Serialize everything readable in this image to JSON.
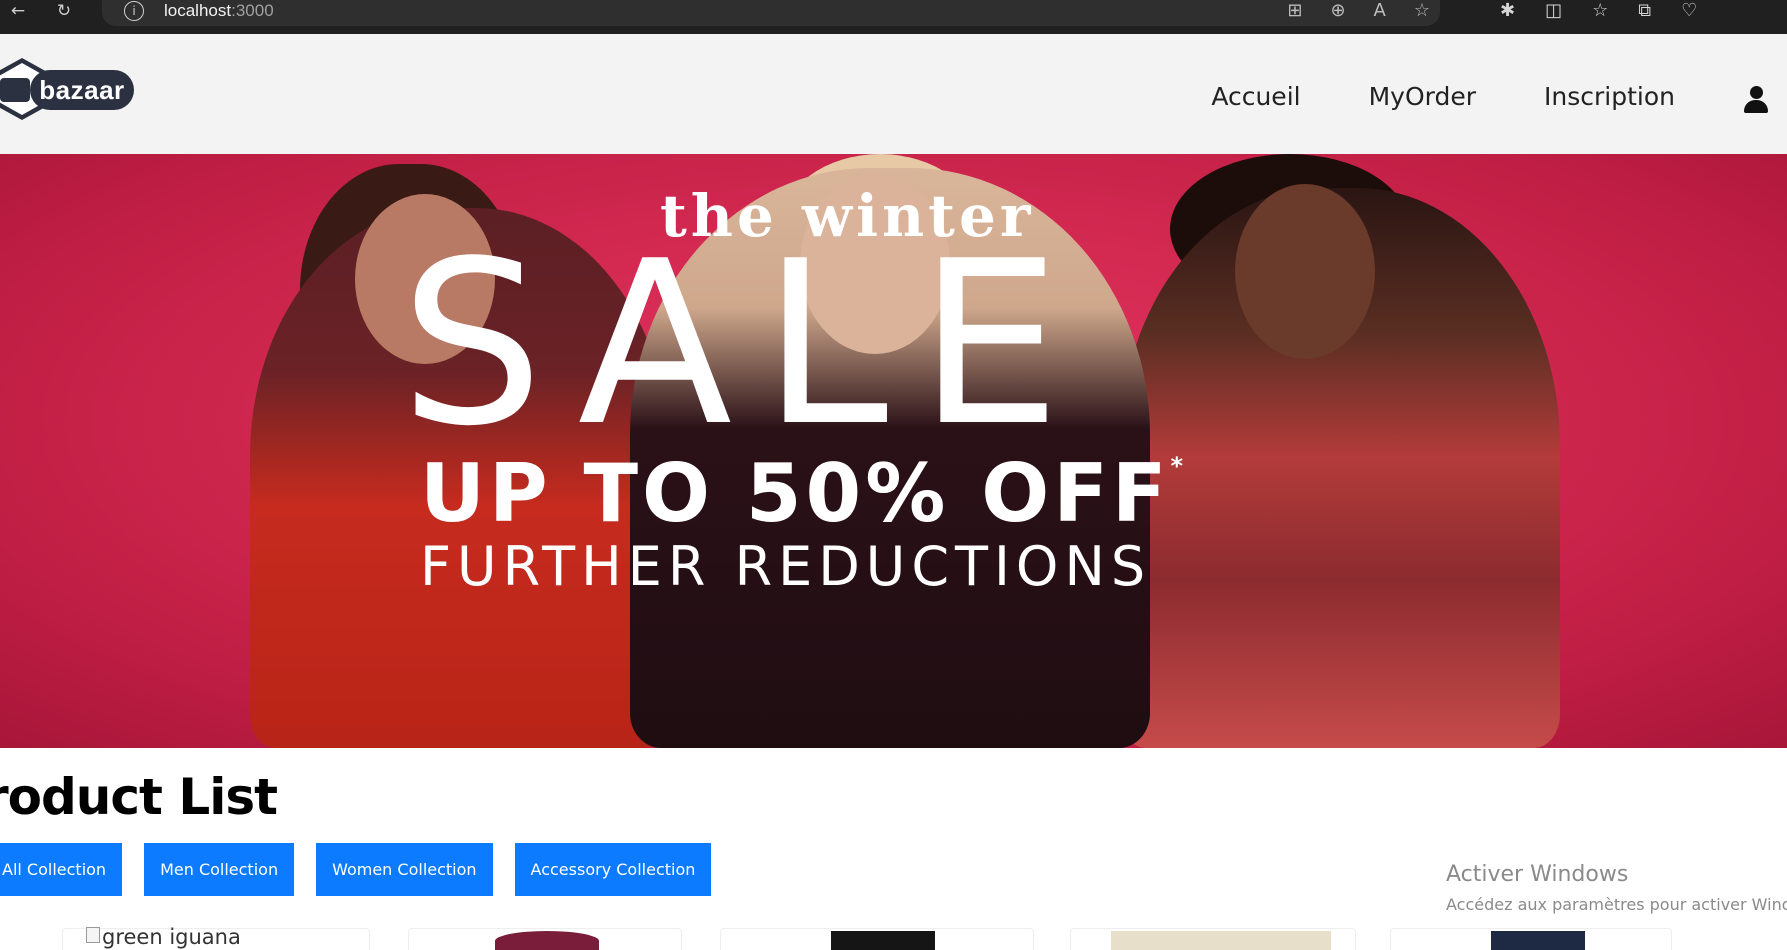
{
  "browser": {
    "url_host": "localhost",
    "url_port": ":3000",
    "icons": [
      "back-icon",
      "reload-icon",
      "info-icon",
      "app-grid-icon",
      "zoom-icon",
      "read-aloud-icon",
      "favorite-star-icon",
      "extensions-icon",
      "split-screen-icon",
      "favorites-icon",
      "collections-icon",
      "health-icon"
    ]
  },
  "header": {
    "logo_text": "bazaar",
    "nav": [
      "Accueil",
      "MyOrder",
      "Inscription"
    ],
    "user_icon": "user-icon"
  },
  "banner": {
    "line1": "the winter",
    "line2": "SALE",
    "line3": "UP TO 50% OFF",
    "line3_mark": "*",
    "line4": "FURTHER REDUCTIONS"
  },
  "products": {
    "title": "roduct List",
    "filters": [
      "All Collection",
      "Men Collection",
      "Women Collection",
      "Accessory Collection"
    ],
    "first_image_alt": "green iguana"
  },
  "watermark": {
    "title": "Activer Windows",
    "subtitle": "Accédez aux paramètres pour activer Windo"
  },
  "colors": {
    "accent": "#0d7bff",
    "navbar_bg": "#f3f3f3",
    "banner_red": "#d42a52",
    "logo_dark": "#2b3140"
  }
}
